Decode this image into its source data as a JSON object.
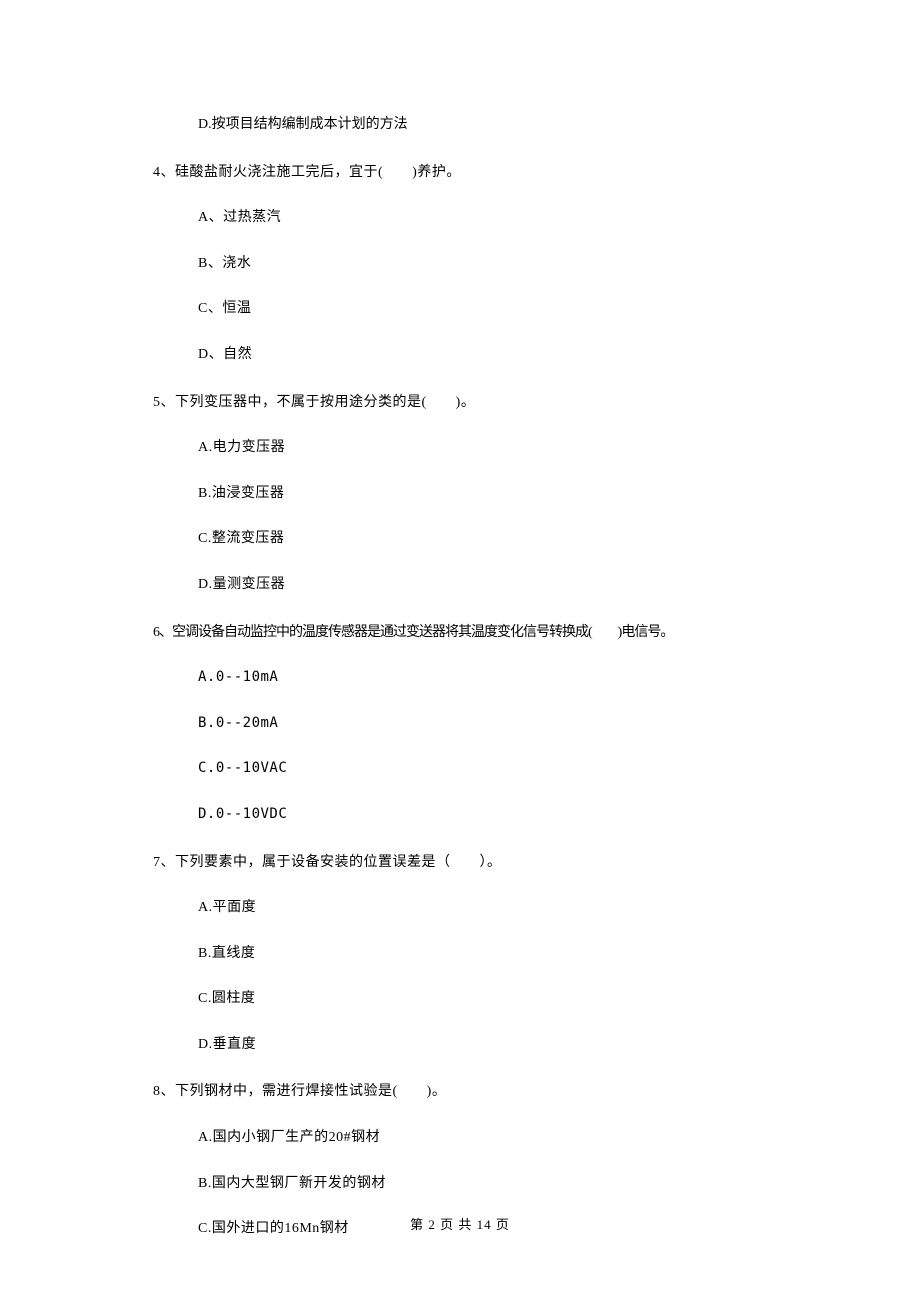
{
  "prev_option": "D.按项目结构编制成本计划的方法",
  "questions": [
    {
      "num": "4",
      "text": "硅酸盐耐火浇注施工完后，宜于(　　)养护。",
      "options": [
        "A、过热蒸汽",
        "B、浇水",
        "C、恒温",
        "D、自然"
      ]
    },
    {
      "num": "5",
      "text": "下列变压器中，不属于按用途分类的是(　　)。",
      "options": [
        "A.电力变压器",
        "B.油浸变压器",
        "C.整流变压器",
        "D.量测变压器"
      ]
    },
    {
      "num": "6",
      "text": "空调设备自动监控中的温度传感器是通过变送器将其温度变化信号转换成(　　)电信号。",
      "options": [
        "A.0--10mA",
        "B.0--20mA",
        "C.0--10VAC",
        "D.0--10VDC"
      ]
    },
    {
      "num": "7",
      "text": "下列要素中，属于设备安装的位置误差是（　　）。",
      "options": [
        "A.平面度",
        "B.直线度",
        "C.圆柱度",
        "D.垂直度"
      ]
    },
    {
      "num": "8",
      "text": "下列钢材中，需进行焊接性试验是(　　)。",
      "options": [
        "A.国内小钢厂生产的20#钢材",
        "B.国内大型钢厂新开发的钢材",
        "C.国外进口的16Mn钢材"
      ]
    }
  ],
  "footer": "第 2 页 共 14 页"
}
